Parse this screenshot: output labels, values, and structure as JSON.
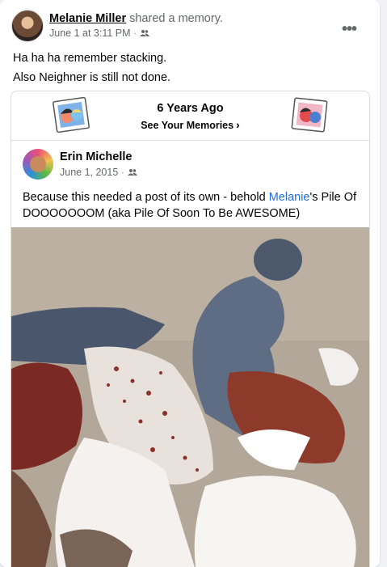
{
  "post": {
    "author": "Melanie Miller",
    "action": " shared a memory.",
    "timestamp": "June 1 at 3:11 PM",
    "separator": "·",
    "audience_icon": "friends-icon",
    "more_label": "•••",
    "caption_lines": [
      "Ha ha ha remember stacking.",
      "Also Neighner is still not done."
    ]
  },
  "memory": {
    "title": "6 Years Ago",
    "link_label": "See Your Memories",
    "link_chevron": "›",
    "original": {
      "author": "Erin Michelle",
      "date": "June 1, 2015",
      "separator": "·",
      "text_before": "Because this needed a post of its own - behold ",
      "mention": "Melanie",
      "text_after": "'s Pile Of DOOOOOOOM (aka Pile Of Soon To Be AWESOME)"
    }
  },
  "colors": {
    "link_blue": "#216fdb",
    "secondary_text": "#65676b",
    "primary_text": "#050505"
  }
}
